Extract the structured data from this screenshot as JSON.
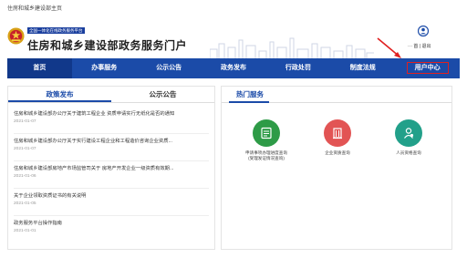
{
  "topbar": {
    "text": "住房和城乡建设部主页"
  },
  "header": {
    "badge": "全国一体化在线政务服务平台",
    "title": "住房和城乡建设部政务服务门户",
    "user_links": "··· 首 | 退出"
  },
  "nav": {
    "items": [
      {
        "label": "首页"
      },
      {
        "label": "办事服务"
      },
      {
        "label": "公示公告"
      },
      {
        "label": "政务发布"
      },
      {
        "label": "行政处罚"
      },
      {
        "label": "制度法规"
      },
      {
        "label": "用户中心"
      }
    ]
  },
  "left_panel": {
    "tabs": [
      {
        "label": "政策发布"
      },
      {
        "label": "公示公告"
      }
    ],
    "news": [
      {
        "title": "住房和城乡建设部办公厅关于建筑工程企业 资质申请实行无纸化是否的通知",
        "date": "2021-01-07"
      },
      {
        "title": "住房和城乡建设部办公厅关于实行建设工程企业和工程造价咨询企业资质...",
        "date": "2021-01-07"
      },
      {
        "title": "住房和城乡建设部房地产市场监管司关于 房地产开发企业一级资质有效期...",
        "date": "2021-01-06"
      },
      {
        "title": "关于企业领取资质证书的有关说明",
        "date": "2021-01-05"
      },
      {
        "title": "政务服务平台操作指南",
        "date": "2021-01-01"
      }
    ]
  },
  "right_panel": {
    "title": "热门服务",
    "services": [
      {
        "label_line1": "申请事项办理进度查询",
        "label_line2": "(受理发证情况查询)",
        "color": "#2e9b47",
        "icon": "document-icon"
      },
      {
        "label_line1": "企业资质查询",
        "label_line2": "",
        "color": "#e25454",
        "icon": "building-icon"
      },
      {
        "label_line1": "人员资格查询",
        "label_line2": "",
        "color": "#22a08a",
        "icon": "person-icon"
      }
    ]
  },
  "colors": {
    "nav_blue": "#1b4ba8",
    "highlight_red": "#e02020"
  }
}
